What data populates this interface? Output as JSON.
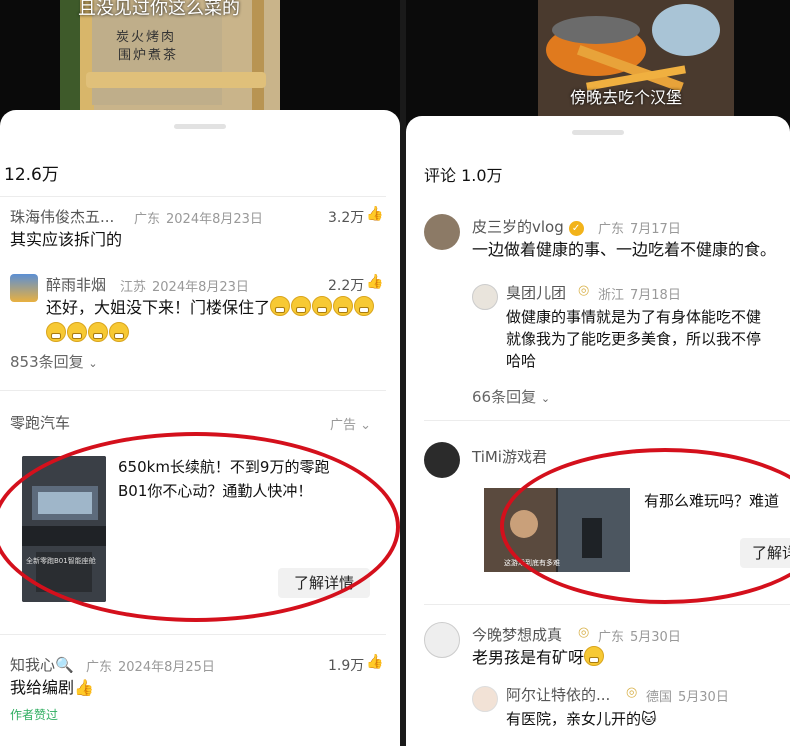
{
  "left": {
    "video_caption": "且没见过你这么菜的",
    "apron_line1": "炭火烤肉",
    "apron_line2": "围炉煮茶",
    "comment_count": "12.6万",
    "comments": [
      {
        "name": "珠海伟俊杰五...",
        "region": "广东",
        "date": "2024年8月23日",
        "likes": "3.2万",
        "text": "其实应该拆门的"
      },
      {
        "name": "醉雨非烟",
        "region": "江苏",
        "date": "2024年8月23日",
        "likes": "2.2万",
        "text": "还好，大姐没下来！门楼保住了"
      }
    ],
    "replies_label": "853条回复",
    "ad": {
      "brand": "零跑汽车",
      "tag": "广告",
      "text_line1": "650km长续航！不到9万的零跑",
      "text_line2": "B01你不心动？通勤人快冲！",
      "cta": "了解详情",
      "image_caption": "全新零跑B01智能座舱"
    },
    "comment3": {
      "name": "知我心",
      "region": "广东",
      "date": "2024年8月25日",
      "likes": "1.9万",
      "text": "我给编剧",
      "author_liked": "作者赞过"
    }
  },
  "right": {
    "video_caption": "傍晚去吃个汉堡",
    "comment_count": "评论 1.0万",
    "c1": {
      "name": "皮三岁的vlog",
      "region": "广东",
      "date": "7月17日",
      "text": "一边做着健康的事、一边吃着不健康的食。"
    },
    "r1": {
      "name": "臭团儿团",
      "region": "浙江",
      "date": "7月18日",
      "line1": "做健康的事情就是为了有身体能吃不健",
      "line2": "就像我为了能吃更多美食，所以我不停",
      "line3": "哈哈"
    },
    "replies_label": "66条回复",
    "ad": {
      "name": "TiMi游戏君",
      "text": "有那么难玩吗？难道",
      "cta": "了解详",
      "image_caption": "这游戏到底有多难"
    },
    "c3": {
      "name": "今晚梦想成真",
      "region": "广东",
      "date": "5月30日",
      "text": "老男孩是有矿呀"
    },
    "r3": {
      "name": "阿尔让特依的...",
      "region": "德国",
      "date": "5月30日",
      "text": "有医院，亲女儿开的"
    }
  },
  "colors": {
    "highlight_ring": "#d4101c",
    "author_liked": "#2fae60",
    "badge": "#f2b31a"
  }
}
